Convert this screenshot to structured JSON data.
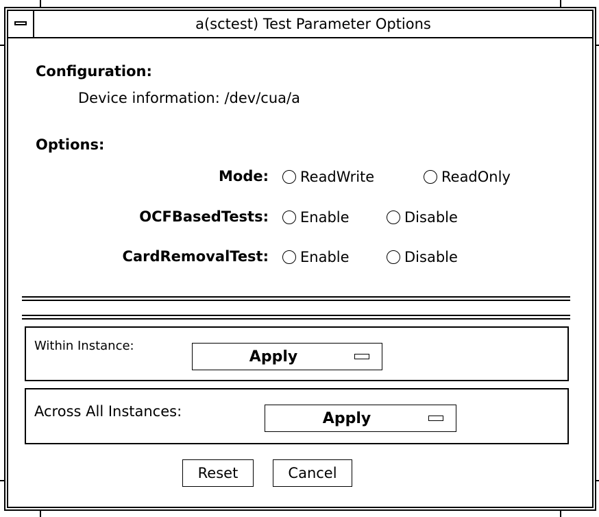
{
  "window": {
    "title": "a(sctest) Test Parameter Options"
  },
  "configuration": {
    "heading": "Configuration:",
    "device_info_label": "Device information:",
    "device_info_value": "/dev/cua/a"
  },
  "options": {
    "heading": "Options:",
    "mode": {
      "label": "Mode:",
      "choices": [
        "ReadWrite",
        "ReadOnly"
      ]
    },
    "ocf": {
      "label": "OCFBasedTests:",
      "choices": [
        "Enable",
        "Disable"
      ]
    },
    "card_removal": {
      "label": "CardRemovalTest:",
      "choices": [
        "Enable",
        "Disable"
      ]
    }
  },
  "within_instance": {
    "label": "Within Instance:",
    "button_label": "Apply"
  },
  "across_instances": {
    "label": "Across All Instances:",
    "button_label": "Apply"
  },
  "actions": {
    "reset_label": "Reset",
    "cancel_label": "Cancel"
  }
}
